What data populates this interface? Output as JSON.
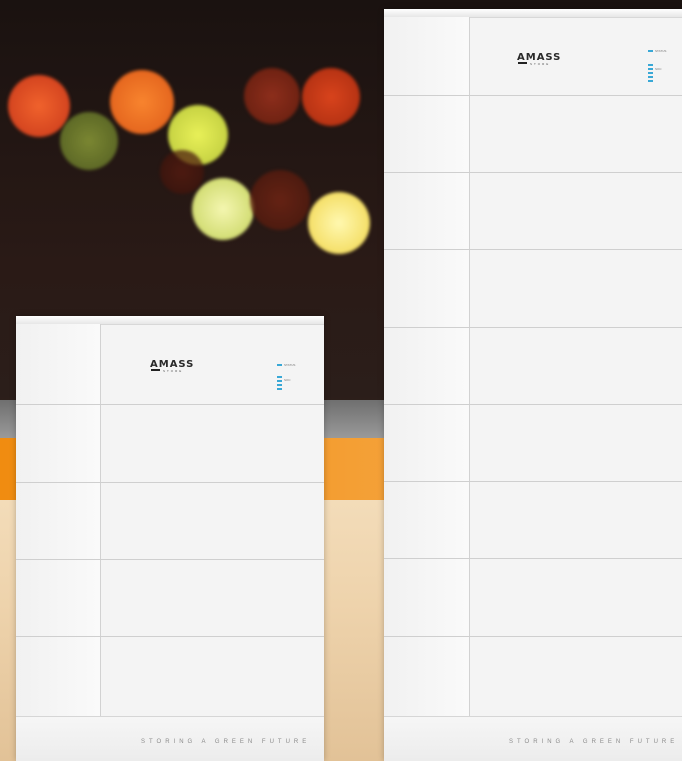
{
  "brand": {
    "logo_text": "AMASS",
    "logo_sub": "STORE"
  },
  "units": [
    {
      "name": "small-battery-unit",
      "slogan": "STORING A GREEN FUTURE",
      "status_label": "STATUS",
      "level_label": "SOC",
      "module_count": 4
    },
    {
      "name": "tall-battery-unit",
      "slogan": "STORING A GREEN FUTURE",
      "status_label": "STATUS",
      "level_label": "SOC",
      "module_count": 8
    }
  ],
  "colors": {
    "accent_orange": "#f5a23a",
    "led_blue": "#39a8d6",
    "panel_white": "#f4f4f4",
    "background_dark": "#1a1210"
  }
}
